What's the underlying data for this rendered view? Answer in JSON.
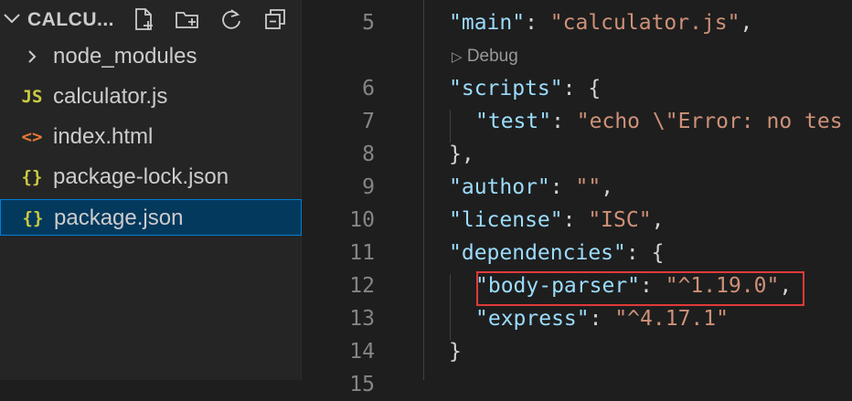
{
  "explorer": {
    "root_folder": "CALCU...",
    "actions": [
      "new-file-icon",
      "new-folder-icon",
      "refresh-icon",
      "collapse-all-icon"
    ],
    "items": [
      {
        "label": "node_modules",
        "icon": "chevron-right-icon",
        "icon_text": "",
        "icon_color": "#cccccc"
      },
      {
        "label": "calculator.js",
        "icon": "javascript-icon",
        "icon_text": "JS",
        "icon_color": "#cbcb41"
      },
      {
        "label": "index.html",
        "icon": "html-icon",
        "icon_text": "<>",
        "icon_color": "#e37933"
      },
      {
        "label": "package-lock.json",
        "icon": "json-icon",
        "icon_text": "{}",
        "icon_color": "#cbcb41"
      },
      {
        "label": "package.json",
        "icon": "json-icon",
        "icon_text": "{}",
        "icon_color": "#cbcb41",
        "selected": true
      }
    ]
  },
  "editor": {
    "codelens": "Debug",
    "lines": [
      {
        "num": "5",
        "code": [
          "\"main\"",
          ": ",
          "\"calculator.js\"",
          ","
        ]
      },
      {
        "num": "6",
        "code": [
          "\"scripts\"",
          ": {"
        ]
      },
      {
        "num": "7",
        "code": [
          "\"test\"",
          ": ",
          "\"echo \\\"Error: no tes"
        ]
      },
      {
        "num": "8",
        "code": [
          "},"
        ]
      },
      {
        "num": "9",
        "code": [
          "\"author\"",
          ": ",
          "\"\"",
          ","
        ]
      },
      {
        "num": "10",
        "code": [
          "\"license\"",
          ": ",
          "\"ISC\"",
          ","
        ]
      },
      {
        "num": "11",
        "code": [
          "\"dependencies\"",
          ": {"
        ]
      },
      {
        "num": "12",
        "code": [
          "\"body-parser\"",
          ": ",
          "\"^1.19.0\"",
          ","
        ]
      },
      {
        "num": "13",
        "code": [
          "\"express\"",
          ": ",
          "\"^4.17.1\""
        ]
      },
      {
        "num": "14",
        "code": [
          "}"
        ]
      },
      {
        "num": "15",
        "code": []
      }
    ]
  },
  "colors": {
    "key": "#9cdcfe",
    "string": "#ce9178",
    "highlight_box": "#e03a3a",
    "selection": "#04395e"
  }
}
